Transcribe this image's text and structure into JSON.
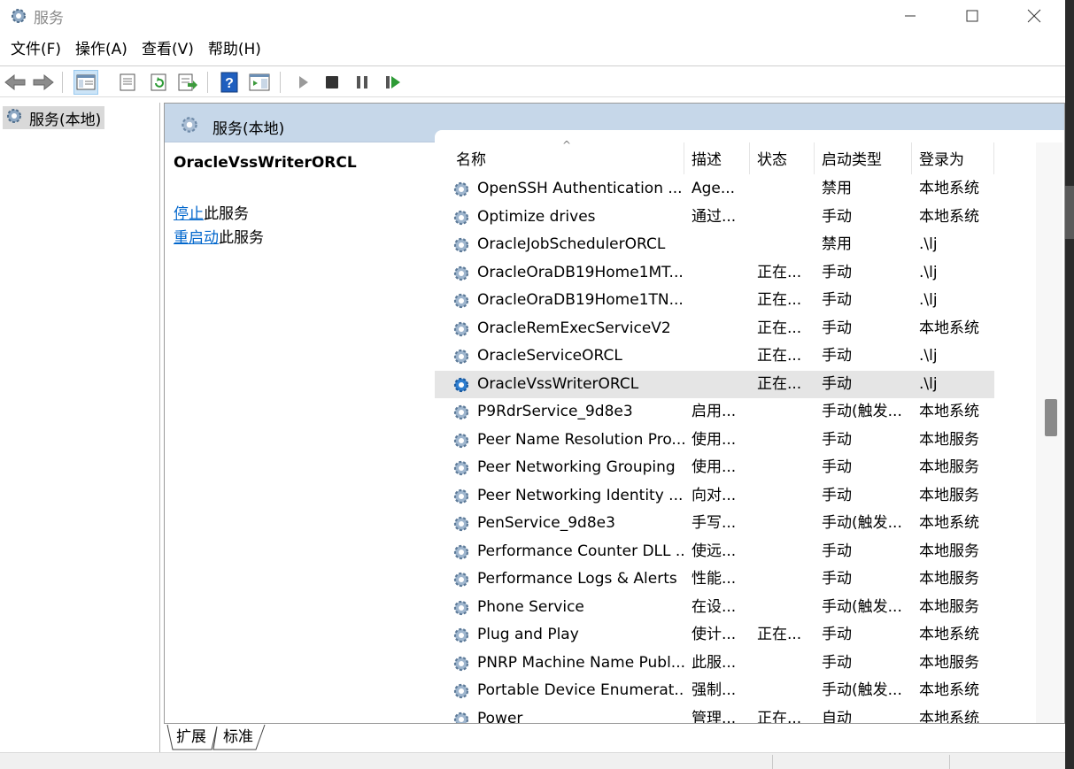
{
  "window": {
    "title": "服务",
    "icon": "services-gear-icon"
  },
  "menu": [
    "文件(F)",
    "操作(A)",
    "查看(V)",
    "帮助(H)"
  ],
  "toolbar": {
    "icons": [
      "back-arrow-icon",
      "forward-arrow-icon",
      "console-tree-icon",
      "properties-icon",
      "refresh-icon",
      "export-list-icon",
      "help-icon",
      "show-hide-action-pane-icon",
      "start-service-icon",
      "stop-service-icon",
      "pause-service-icon",
      "restart-service-icon"
    ]
  },
  "tree": {
    "root_label": "服务(本地)"
  },
  "panel": {
    "title": "服务(本地)",
    "selected_service": "OracleVssWriterORCL",
    "actions": [
      {
        "link": "停止",
        "rest": "此服务"
      },
      {
        "link": "重启动",
        "rest": "此服务"
      }
    ]
  },
  "table": {
    "columns": [
      "名称",
      "描述",
      "状态",
      "启动类型",
      "登录为"
    ],
    "rows": [
      {
        "name": "OpenSSH Authentication ...",
        "desc": "Age...",
        "status": "",
        "startup": "禁用",
        "logon": "本地系统"
      },
      {
        "name": "Optimize drives",
        "desc": "通过...",
        "status": "",
        "startup": "手动",
        "logon": "本地系统"
      },
      {
        "name": "OracleJobSchedulerORCL",
        "desc": "",
        "status": "",
        "startup": "禁用",
        "logon": ".\\lj"
      },
      {
        "name": "OracleOraDB19Home1MT...",
        "desc": "",
        "status": "正在...",
        "startup": "手动",
        "logon": ".\\lj"
      },
      {
        "name": "OracleOraDB19Home1TN...",
        "desc": "",
        "status": "正在...",
        "startup": "手动",
        "logon": ".\\lj"
      },
      {
        "name": "OracleRemExecServiceV2",
        "desc": "",
        "status": "正在...",
        "startup": "手动",
        "logon": "本地系统"
      },
      {
        "name": "OracleServiceORCL",
        "desc": "",
        "status": "正在...",
        "startup": "手动",
        "logon": ".\\lj"
      },
      {
        "name": "OracleVssWriterORCL",
        "desc": "",
        "status": "正在...",
        "startup": "手动",
        "logon": ".\\lj",
        "selected": true
      },
      {
        "name": "P9RdrService_9d8e3",
        "desc": "启用...",
        "status": "",
        "startup": "手动(触发...",
        "logon": "本地系统"
      },
      {
        "name": "Peer Name Resolution Pro...",
        "desc": "使用...",
        "status": "",
        "startup": "手动",
        "logon": "本地服务"
      },
      {
        "name": "Peer Networking Grouping",
        "desc": "使用...",
        "status": "",
        "startup": "手动",
        "logon": "本地服务"
      },
      {
        "name": "Peer Networking Identity ...",
        "desc": "向对...",
        "status": "",
        "startup": "手动",
        "logon": "本地服务"
      },
      {
        "name": "PenService_9d8e3",
        "desc": "手写...",
        "status": "",
        "startup": "手动(触发...",
        "logon": "本地系统"
      },
      {
        "name": "Performance Counter DLL ...",
        "desc": "使远...",
        "status": "",
        "startup": "手动",
        "logon": "本地服务"
      },
      {
        "name": "Performance Logs & Alerts",
        "desc": "性能...",
        "status": "",
        "startup": "手动",
        "logon": "本地服务"
      },
      {
        "name": "Phone Service",
        "desc": "在设...",
        "status": "",
        "startup": "手动(触发...",
        "logon": "本地服务"
      },
      {
        "name": "Plug and Play",
        "desc": "使计...",
        "status": "正在...",
        "startup": "手动",
        "logon": "本地系统"
      },
      {
        "name": "PNRP Machine Name Publ...",
        "desc": "此服...",
        "status": "",
        "startup": "手动",
        "logon": "本地服务"
      },
      {
        "name": "Portable Device Enumerat...",
        "desc": "强制...",
        "status": "",
        "startup": "手动(触发...",
        "logon": "本地系统"
      },
      {
        "name": "Power",
        "desc": "管理...",
        "status": "正在...",
        "startup": "自动",
        "logon": "本地系统"
      }
    ]
  },
  "tabs": [
    "扩展",
    "标准"
  ]
}
